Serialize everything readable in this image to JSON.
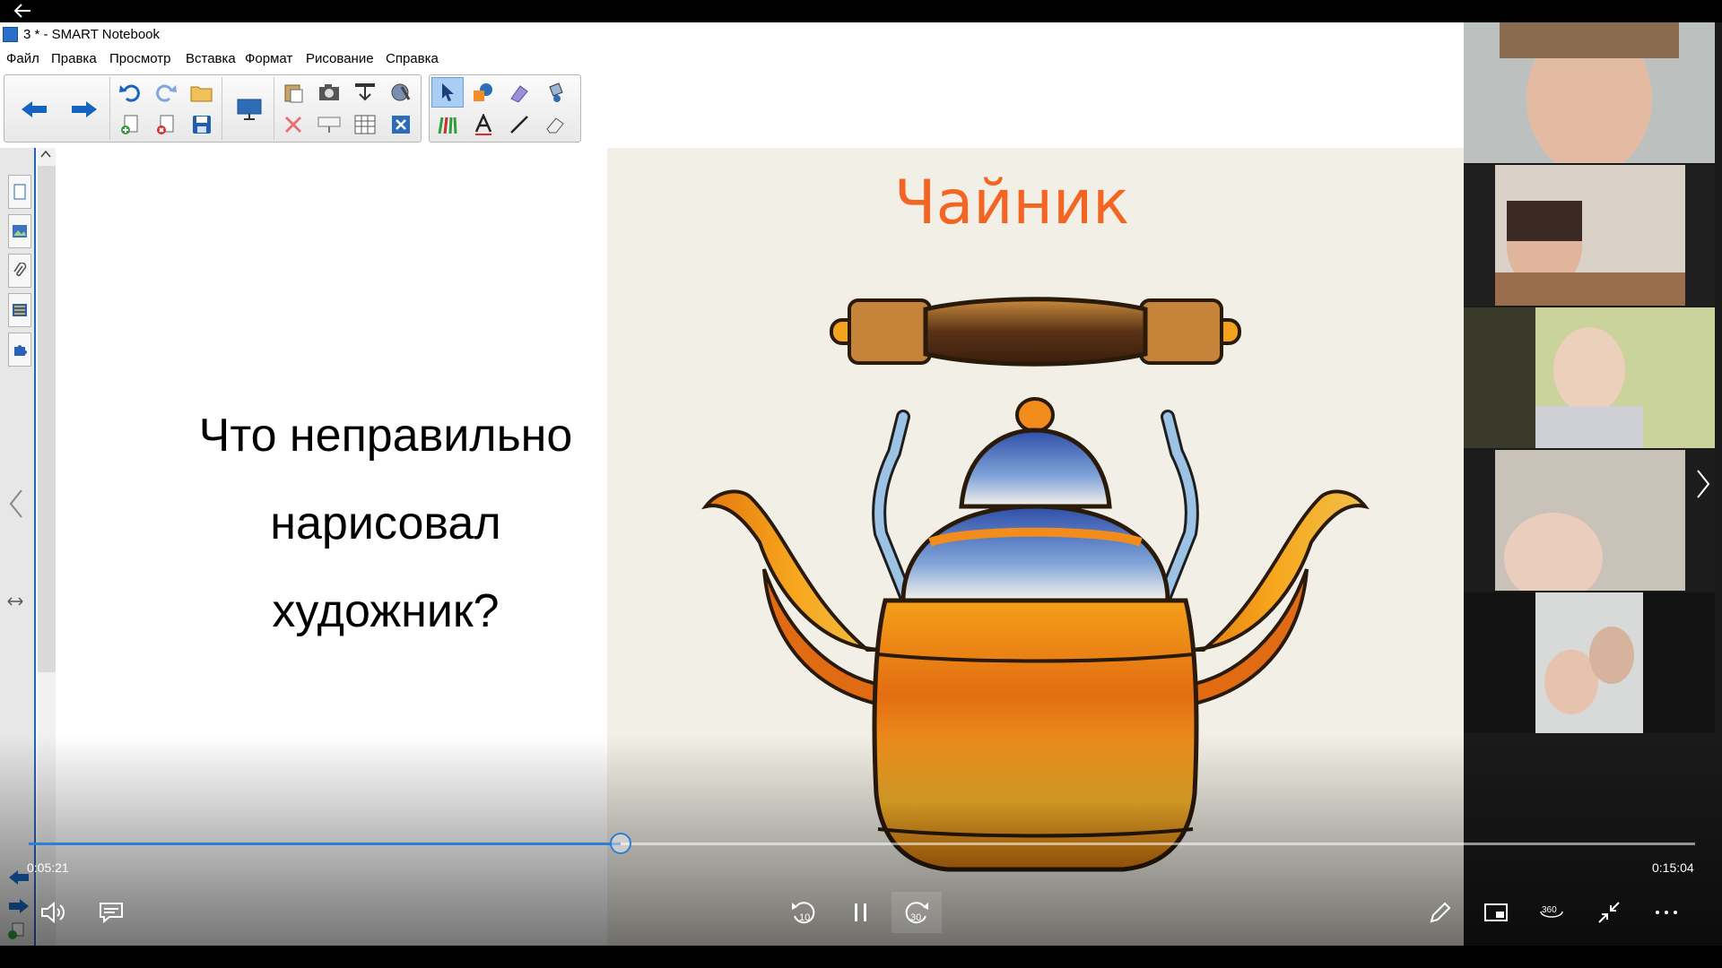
{
  "window": {
    "title": "3 * - SMART Notebook"
  },
  "menu": [
    "Файл",
    "Правка",
    "Просмотр",
    "Вставка",
    "Формат",
    "Рисование",
    "Справка"
  ],
  "slide": {
    "question_lines": [
      "Что неправильно",
      "нарисовал",
      "художник?"
    ],
    "picture_title": "Чайник"
  },
  "player": {
    "elapsed": "0:05:21",
    "total": "0:15:04",
    "progress_fraction": 0.355,
    "skip_back_label": "10",
    "skip_forward_label": "30"
  },
  "participants_count": 5,
  "colors": {
    "accent": "#2d7fd8",
    "title_orange": "#f26522"
  }
}
